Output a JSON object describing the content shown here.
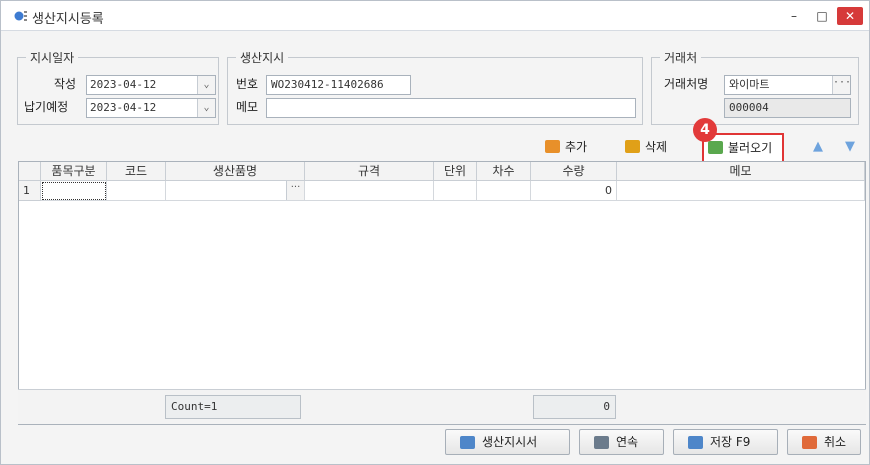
{
  "window": {
    "title": "생산지시등록",
    "min_glyph": "–",
    "max_glyph": "□",
    "close_glyph": "✕"
  },
  "order_date_group": {
    "title": "지시일자",
    "created_label": "작성",
    "created_value": "2023-04-12",
    "due_label": "납기예정",
    "due_value": "2023-04-12",
    "dropdown_glyph": "⌄"
  },
  "production_order_group": {
    "title": "생산지시",
    "number_label": "번호",
    "number_value": "WO230412-11402686",
    "memo_label": "메모",
    "memo_value": ""
  },
  "client_group": {
    "title": "거래처",
    "name_label": "거래처명",
    "name_value": "와이마트",
    "code_value": "000004",
    "lookup_glyph": "···"
  },
  "toolbar": {
    "add_label": "추가",
    "delete_label": "삭제",
    "load_label": "불러오기",
    "step_badge": "4",
    "up_glyph": "▲",
    "down_glyph": "▼",
    "colors": {
      "add_icon": "#e8902a",
      "delete_icon": "#e0a018",
      "callout": "#e03535",
      "arrow": "#6ea3dd"
    }
  },
  "grid": {
    "columns": [
      "품목구분",
      "코드",
      "생산품명",
      "규격",
      "단위",
      "차수",
      "수량",
      "메모"
    ],
    "rows": [
      {
        "index": "1",
        "category": "",
        "code": "",
        "product": "",
        "spec": "",
        "unit": "",
        "order_no": "",
        "quantity": "0",
        "memo": ""
      }
    ],
    "lookup_glyph": "···",
    "footer_count": "Count=1",
    "footer_quantity_total": "0"
  },
  "bottom_buttons": {
    "print_order_label": "생산지시서",
    "continuous_label": "연속",
    "save_label": "저장 F9",
    "cancel_label": "취소"
  }
}
